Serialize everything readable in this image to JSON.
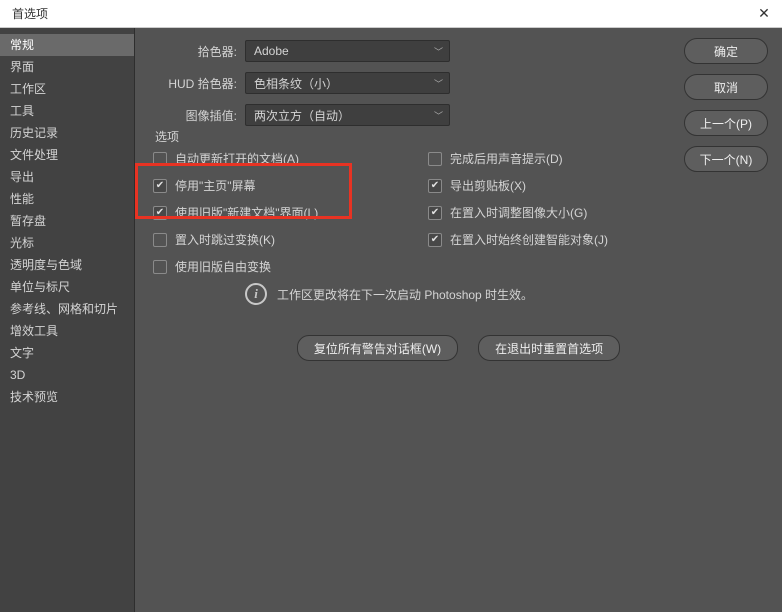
{
  "window": {
    "title": "首选项"
  },
  "sidebar": {
    "items": [
      "常规",
      "界面",
      "工作区",
      "工具",
      "历史记录",
      "文件处理",
      "导出",
      "性能",
      "暂存盘",
      "光标",
      "透明度与色域",
      "单位与标尺",
      "参考线、网格和切片",
      "增效工具",
      "文字",
      "3D",
      "技术预览"
    ],
    "selected_index": 0
  },
  "selectors": {
    "picker_label": "拾色器:",
    "picker_value": "Adobe",
    "hud_label": "HUD 拾色器:",
    "hud_value": "色相条纹（小）",
    "interp_label": "图像插值:",
    "interp_value": "两次立方（自动）"
  },
  "fieldset_label": "选项",
  "options": {
    "left": [
      {
        "label": "自动更新打开的文档(A)",
        "checked": false
      },
      {
        "label": "停用\"主页\"屏幕",
        "checked": true
      },
      {
        "label": "使用旧版\"新建文档\"界面(L)",
        "checked": true
      },
      {
        "label": "置入时跳过变换(K)",
        "checked": false
      },
      {
        "label": "使用旧版自由变换",
        "checked": false
      }
    ],
    "right": [
      {
        "label": "完成后用声音提示(D)",
        "checked": false
      },
      {
        "label": "导出剪贴板(X)",
        "checked": true
      },
      {
        "label": "在置入时调整图像大小(G)",
        "checked": true
      },
      {
        "label": "在置入时始终创建智能对象(J)",
        "checked": true
      }
    ]
  },
  "info_text": "工作区更改将在下一次启动 Photoshop 时生效。",
  "bottom": {
    "reset_warnings": "复位所有警告对话框(W)",
    "reset_on_quit": "在退出时重置首选项"
  },
  "right_buttons": {
    "ok": "确定",
    "cancel": "取消",
    "prev": "上一个(P)",
    "next": "下一个(N)"
  }
}
